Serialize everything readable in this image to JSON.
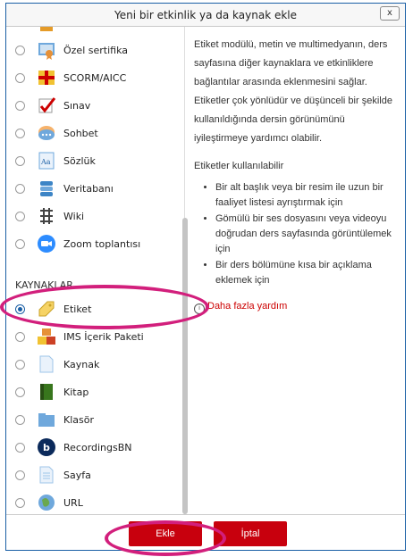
{
  "dialog": {
    "title": "Yeni bir etkinlik ya da kaynak ekle",
    "close_label": "x"
  },
  "activities": [
    {
      "label": "Özel sertifika",
      "icon": "certificate-icon"
    },
    {
      "label": "SCORM/AICC",
      "icon": "scorm-package-icon"
    },
    {
      "label": "Sınav",
      "icon": "quiz-checkmark-icon"
    },
    {
      "label": "Sohbet",
      "icon": "chat-bubble-icon"
    },
    {
      "label": "Sözlük",
      "icon": "glossary-icon"
    },
    {
      "label": "Veritabanı",
      "icon": "database-icon"
    },
    {
      "label": "Wiki",
      "icon": "wiki-icon"
    },
    {
      "label": "Zoom toplantısı",
      "icon": "zoom-camera-icon"
    }
  ],
  "resources_header": "KAYNAKLAR",
  "resources": [
    {
      "label": "Etiket",
      "icon": "label-tag-icon",
      "selected": true
    },
    {
      "label": "IMS İçerik Paketi",
      "icon": "ims-package-icon"
    },
    {
      "label": "Kaynak",
      "icon": "file-icon"
    },
    {
      "label": "Kitap",
      "icon": "book-icon"
    },
    {
      "label": "Klasör",
      "icon": "folder-icon"
    },
    {
      "label": "RecordingsBN",
      "icon": "recordings-icon"
    },
    {
      "label": "Sayfa",
      "icon": "page-icon"
    },
    {
      "label": "URL",
      "icon": "url-globe-icon"
    }
  ],
  "description": {
    "intro": "Etiket modülü, metin ve multimedyanın, ders sayfasına diğer kaynaklara ve etkinliklere bağlantılar arasında eklenmesini sağlar. Etiketler çok yönlüdür ve düşünceli bir şekilde kullanıldığında dersin görünümünü iyileştirmeye yardımcı olabilir.",
    "usage_title": "Etiketler kullanılabilir",
    "usages": [
      "Bir alt başlık veya bir resim ile uzun bir faaliyet listesi ayrıştırmak için",
      "Gömülü bir ses dosyasını veya videoyu doğrudan ders sayfasında görüntülemek için",
      "Bir ders bölümüne kısa bir açıklama eklemek için"
    ],
    "help_link": "Daha fazla yardım"
  },
  "footer": {
    "add_label": "Ekle",
    "cancel_label": "İptal"
  },
  "colors": {
    "accent": "#1a5fa5",
    "button": "#c8000d",
    "highlight": "#d21f7c"
  }
}
